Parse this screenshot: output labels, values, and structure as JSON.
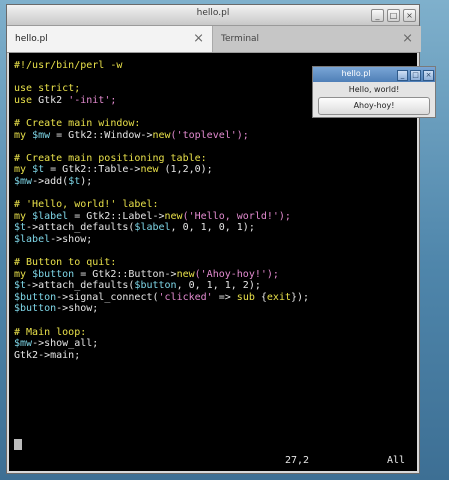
{
  "editor_window": {
    "title": "hello.pl",
    "tabs": [
      {
        "label": "hello.pl",
        "close": "⨯"
      },
      {
        "label": "Terminal",
        "close": "⨯"
      }
    ],
    "controls": {
      "min": "_",
      "max": "□",
      "close": "×"
    },
    "code_lines": [
      [
        {
          "t": "#!/usr/bin/perl -w",
          "c": "comment"
        }
      ],
      [],
      [
        {
          "t": "use strict;",
          "c": "kw"
        }
      ],
      [
        {
          "t": "use ",
          "c": "kw"
        },
        {
          "t": "Gtk2 ",
          "c": "plain"
        },
        {
          "t": "'-init';",
          "c": "str"
        }
      ],
      [],
      [
        {
          "t": "# Create main window:",
          "c": "comment"
        }
      ],
      [
        {
          "t": "my ",
          "c": "kw"
        },
        {
          "t": "$mw",
          "c": "var"
        },
        {
          "t": " = Gtk2::Window->",
          "c": "plain"
        },
        {
          "t": "new",
          "c": "kw"
        },
        {
          "t": "('toplevel');",
          "c": "str"
        }
      ],
      [],
      [
        {
          "t": "# Create main positioning table:",
          "c": "comment"
        }
      ],
      [
        {
          "t": "my ",
          "c": "kw"
        },
        {
          "t": "$t",
          "c": "var"
        },
        {
          "t": " = Gtk2::Table->",
          "c": "plain"
        },
        {
          "t": "new",
          "c": "kw"
        },
        {
          "t": " (1,2,0);",
          "c": "plain"
        }
      ],
      [
        {
          "t": "$mw",
          "c": "var"
        },
        {
          "t": "->add(",
          "c": "plain"
        },
        {
          "t": "$t",
          "c": "var"
        },
        {
          "t": ");",
          "c": "plain"
        }
      ],
      [],
      [
        {
          "t": "# 'Hello, world!' label:",
          "c": "comment"
        }
      ],
      [
        {
          "t": "my ",
          "c": "kw"
        },
        {
          "t": "$label",
          "c": "var"
        },
        {
          "t": " = Gtk2::Label->",
          "c": "plain"
        },
        {
          "t": "new",
          "c": "kw"
        },
        {
          "t": "('Hello, world!');",
          "c": "str"
        }
      ],
      [
        {
          "t": "$t",
          "c": "var"
        },
        {
          "t": "->attach_defaults(",
          "c": "plain"
        },
        {
          "t": "$label",
          "c": "var"
        },
        {
          "t": ", 0, 1, 0, 1);",
          "c": "plain"
        }
      ],
      [
        {
          "t": "$label",
          "c": "var"
        },
        {
          "t": "->show;",
          "c": "plain"
        }
      ],
      [],
      [
        {
          "t": "# Button to quit:",
          "c": "comment"
        }
      ],
      [
        {
          "t": "my ",
          "c": "kw"
        },
        {
          "t": "$button",
          "c": "var"
        },
        {
          "t": " = Gtk2::Button->",
          "c": "plain"
        },
        {
          "t": "new",
          "c": "kw"
        },
        {
          "t": "('Ahoy-hoy!');",
          "c": "str"
        }
      ],
      [
        {
          "t": "$t",
          "c": "var"
        },
        {
          "t": "->attach_defaults(",
          "c": "plain"
        },
        {
          "t": "$button",
          "c": "var"
        },
        {
          "t": ", 0, 1, 1, 2);",
          "c": "plain"
        }
      ],
      [
        {
          "t": "$button",
          "c": "var"
        },
        {
          "t": "->signal_connect(",
          "c": "plain"
        },
        {
          "t": "'clicked'",
          "c": "str"
        },
        {
          "t": " => ",
          "c": "plain"
        },
        {
          "t": "sub",
          "c": "kw"
        },
        {
          "t": " {",
          "c": "plain"
        },
        {
          "t": "exit",
          "c": "kw"
        },
        {
          "t": "});",
          "c": "plain"
        }
      ],
      [
        {
          "t": "$button",
          "c": "var"
        },
        {
          "t": "->show;",
          "c": "plain"
        }
      ],
      [],
      [
        {
          "t": "# Main loop:",
          "c": "comment"
        }
      ],
      [
        {
          "t": "$mw",
          "c": "var"
        },
        {
          "t": "->show_all;",
          "c": "plain"
        }
      ],
      [
        {
          "t": "Gtk2->main;",
          "c": "plain"
        }
      ]
    ],
    "status": {
      "position": "27,2",
      "scroll": "All"
    }
  },
  "popup_window": {
    "title": "hello.pl",
    "label": "Hello, world!",
    "button": "Ahoy-hoy!",
    "controls": {
      "min": "_",
      "max": "□",
      "close": "×"
    }
  }
}
